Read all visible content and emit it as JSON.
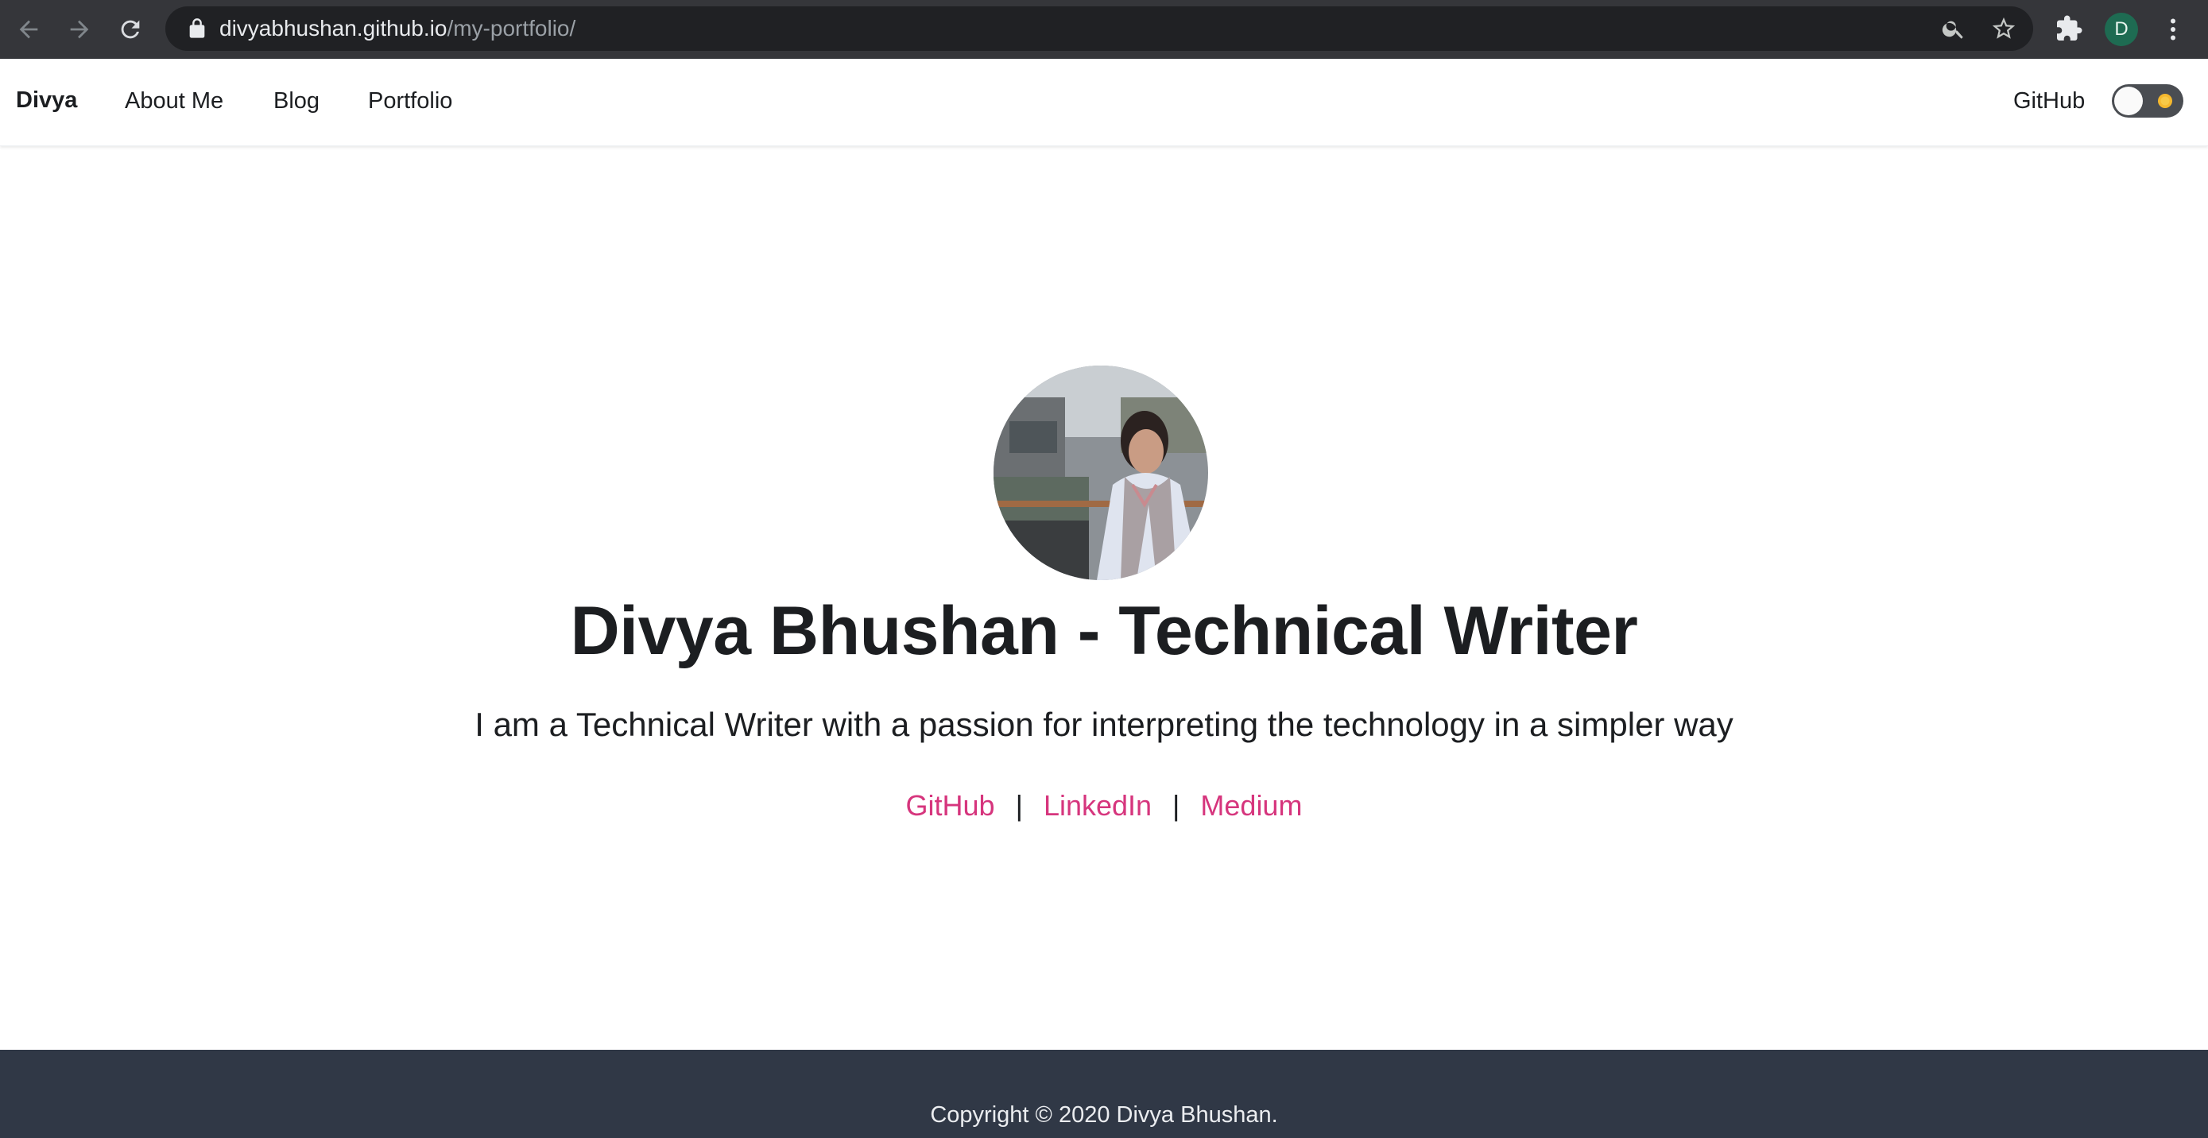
{
  "browser": {
    "url_host": "divyabhushan.github.io",
    "url_path": "/my-portfolio/",
    "profile_initial": "D",
    "icons": [
      "back-arrow-icon",
      "forward-arrow-icon",
      "reload-icon",
      "lock-icon",
      "zoom-icon",
      "star-icon",
      "extensions-icon",
      "kebab-menu-icon"
    ]
  },
  "navbar": {
    "brand": "Divya",
    "links": [
      "About Me",
      "Blog",
      "Portfolio"
    ],
    "github": "GitHub",
    "theme_toggle": {
      "state": "light",
      "icon": "sun-icon"
    }
  },
  "hero": {
    "title": "Divya Bhushan - Technical Writer",
    "tagline": "I am a Technical Writer with a passion for interpreting the technology in a simpler way",
    "links": [
      "GitHub",
      "LinkedIn",
      "Medium"
    ],
    "separator": "|",
    "link_color": "#d6357d"
  },
  "footer": {
    "copyright": "Copyright © 2020 Divya Bhushan."
  },
  "colors": {
    "chrome": "#35363a",
    "omnibox": "#202124",
    "footer": "#303846",
    "text": "#1c1e21",
    "accent": "#d6357d"
  }
}
